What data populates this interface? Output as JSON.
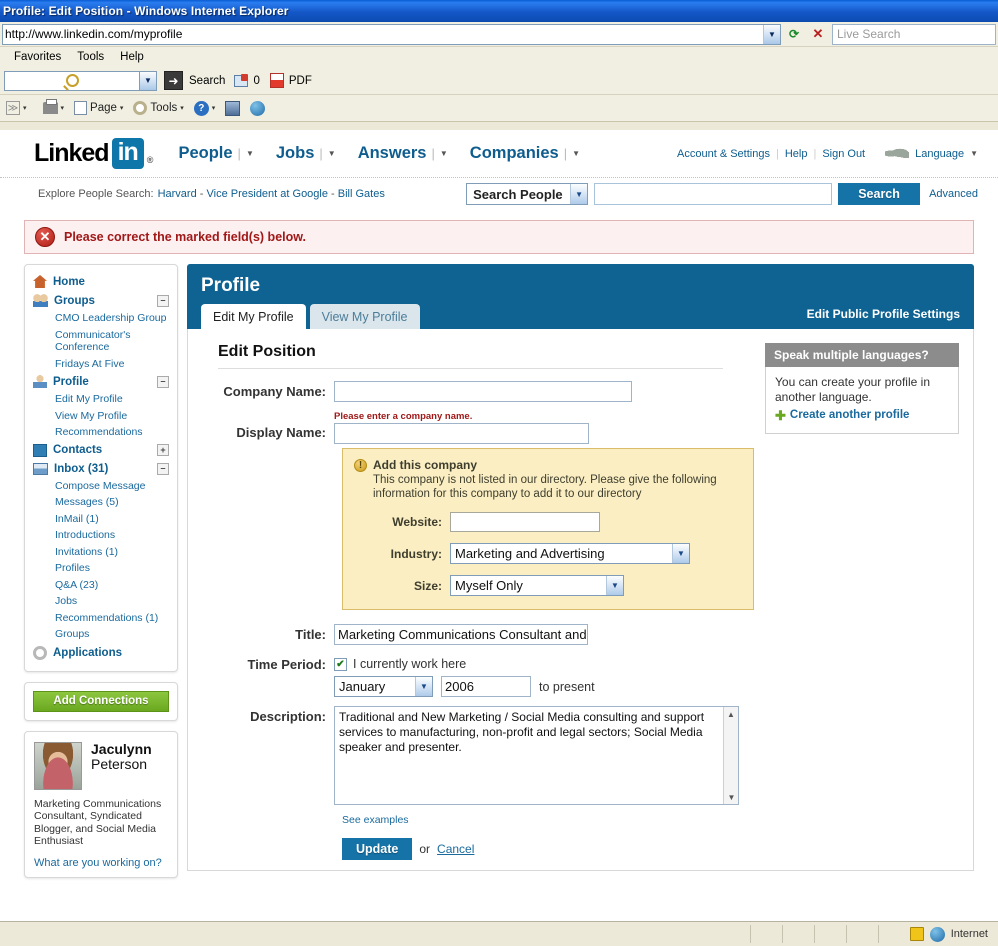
{
  "window": {
    "title": "Profile: Edit Position - Windows Internet Explorer"
  },
  "browser": {
    "url": "http://www.linkedin.com/myprofile",
    "live_search_placeholder": "Live Search",
    "refresh_icon": "refresh-icon",
    "stop_icon": "stop-icon",
    "menu": [
      "Favorites",
      "Tools",
      "Help"
    ],
    "search_toolbar": {
      "search_label": "Search",
      "mail_count": "0",
      "pdf_label": "PDF",
      "search_icon": "magnifier-icon",
      "go_icon": "go-arrow-icon"
    },
    "command_bar": {
      "rss_label": "",
      "page_label": "Page",
      "tools_label": "Tools",
      "rss_icon": "rss-icon",
      "print_icon": "printer-icon",
      "page_icon": "page-icon",
      "gear_icon": "gear-icon",
      "help_icon": "help-icon",
      "research_icon": "research-icon",
      "messenger_icon": "messenger-icon"
    },
    "status": {
      "zone": "Internet",
      "lock_icon": "lock-icon",
      "globe_icon": "globe-icon"
    }
  },
  "linkedin_header": {
    "logo_linked": "Linked",
    "logo_in": "in",
    "logo_registered": "®",
    "nav": [
      {
        "label": "People"
      },
      {
        "label": "Jobs"
      },
      {
        "label": "Answers"
      },
      {
        "label": "Companies"
      }
    ],
    "account_settings": "Account & Settings",
    "help": "Help",
    "sign_out": "Sign Out",
    "language": "Language",
    "globe_icon": "world-map-icon"
  },
  "search_strip": {
    "explore_label": "Explore People Search:",
    "links": [
      "Harvard",
      "Vice President at Google",
      "Bill Gates"
    ],
    "scope_selected": "Search People",
    "query_value": "",
    "search_button": "Search",
    "advanced_link": "Advanced"
  },
  "error_banner": {
    "message": "Please correct the marked field(s) below.",
    "icon": "error-x-icon"
  },
  "sidebar": {
    "nav": [
      {
        "label": "Home",
        "icon": "home-icon",
        "toggle": "",
        "children": []
      },
      {
        "label": "Groups",
        "icon": "groups-icon",
        "toggle": "–",
        "children": [
          "CMO Leadership Group",
          "Communicator's Conference",
          "Fridays At Five"
        ]
      },
      {
        "label": "Profile",
        "icon": "profile-icon",
        "toggle": "–",
        "children": [
          "Edit My Profile",
          "View My Profile",
          "Recommendations"
        ]
      },
      {
        "label": "Contacts",
        "icon": "contacts-icon",
        "toggle": "+",
        "children": []
      },
      {
        "label": "Inbox (31)",
        "icon": "inbox-icon",
        "toggle": "–",
        "children": [
          "Compose Message",
          "Messages (5)",
          "InMail (1)",
          "Introductions",
          "Invitations (1)",
          "Profiles",
          "Q&A (23)",
          "Jobs",
          "Recommendations (1)",
          "Groups"
        ]
      },
      {
        "label": "Applications",
        "icon": "applications-icon",
        "toggle": "",
        "children": []
      }
    ],
    "add_connections": "Add Connections",
    "person": {
      "first_name": "Jaculynn",
      "last_name": "Peterson",
      "headline": "Marketing Communications Consultant, Syndicated Blogger, and Social Media Enthusiast",
      "status_prompt": "What are you working on?",
      "avatar": "avatar"
    }
  },
  "profile_panel": {
    "title": "Profile",
    "tabs": [
      {
        "label": "Edit My Profile",
        "active": true
      },
      {
        "label": "View My Profile",
        "active": false
      }
    ],
    "edit_public_profile": "Edit Public Profile Settings"
  },
  "form": {
    "section_title": "Edit Position",
    "company_name": {
      "label": "Company Name:",
      "value": "",
      "error": "Please enter a company name."
    },
    "display_name": {
      "label": "Display Name:",
      "value": ""
    },
    "add_company": {
      "title": "Add this company",
      "description": "This company is not listed in our directory. Please give the following information for this company to add it to our directory",
      "warning_icon": "warning-icon",
      "website": {
        "label": "Website:",
        "value": ""
      },
      "industry": {
        "label": "Industry:",
        "value": "Marketing and Advertising"
      },
      "size": {
        "label": "Size:",
        "value": "Myself Only"
      }
    },
    "title_field": {
      "label": "Title:",
      "value": "Marketing Communications Consultant and C"
    },
    "time_period": {
      "label": "Time Period:",
      "checkbox_label": "I currently work here",
      "checkbox_checked": "✔",
      "month": "January",
      "year": "2006",
      "to_present": "to present"
    },
    "description": {
      "label": "Description:",
      "value": "Traditional and New Marketing / Social Media consulting and support services to manufacturing, non-profit and legal sectors; Social Media speaker and presenter.",
      "see_examples": "See examples"
    },
    "update_button": "Update",
    "or_text": "or",
    "cancel_link": "Cancel"
  },
  "promo": {
    "heading": "Speak multiple languages?",
    "body": "You can create your profile in another language.",
    "link": "Create another profile",
    "plus_icon": "plus-icon"
  }
}
